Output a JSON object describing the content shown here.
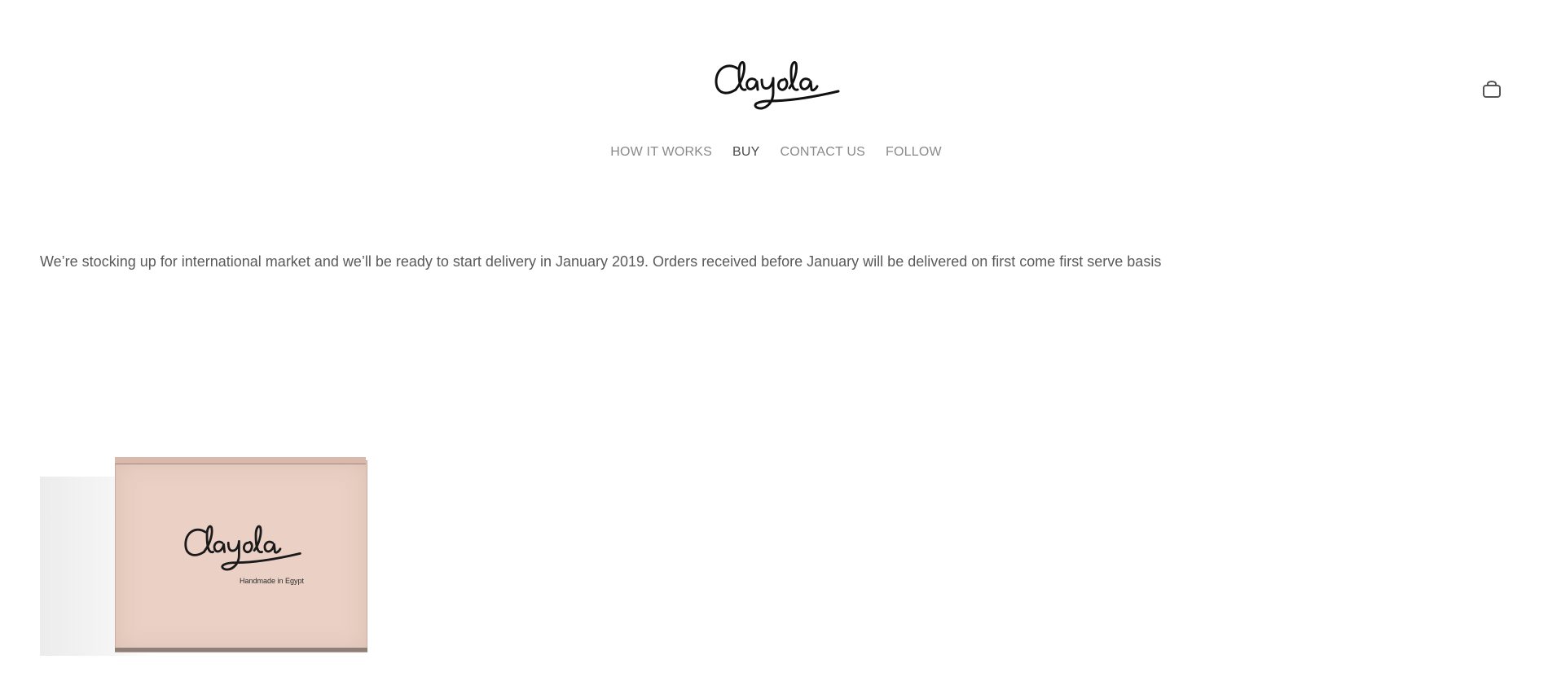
{
  "brand": {
    "logo_text": "Clayola"
  },
  "nav": {
    "items": [
      {
        "label": "HOW IT WORKS",
        "active": false
      },
      {
        "label": "BUY",
        "active": true
      },
      {
        "label": "CONTACT US",
        "active": false
      },
      {
        "label": "FOLLOW",
        "active": false
      }
    ]
  },
  "cart": {
    "icon": "shopping-bag-icon"
  },
  "main": {
    "notice": "We’re stocking up for international market and we’ll be ready to start delivery in January 2019. Orders received before January will be delivered on first come first serve basis"
  },
  "product": {
    "box_logo_text": "Clayola",
    "box_caption": "Handmade in Egypt",
    "box_color": "#ead0c5"
  },
  "colors": {
    "nav_text": "#8a8a8a",
    "nav_active": "#4a4a4a",
    "body_text": "#5a5a5a"
  }
}
